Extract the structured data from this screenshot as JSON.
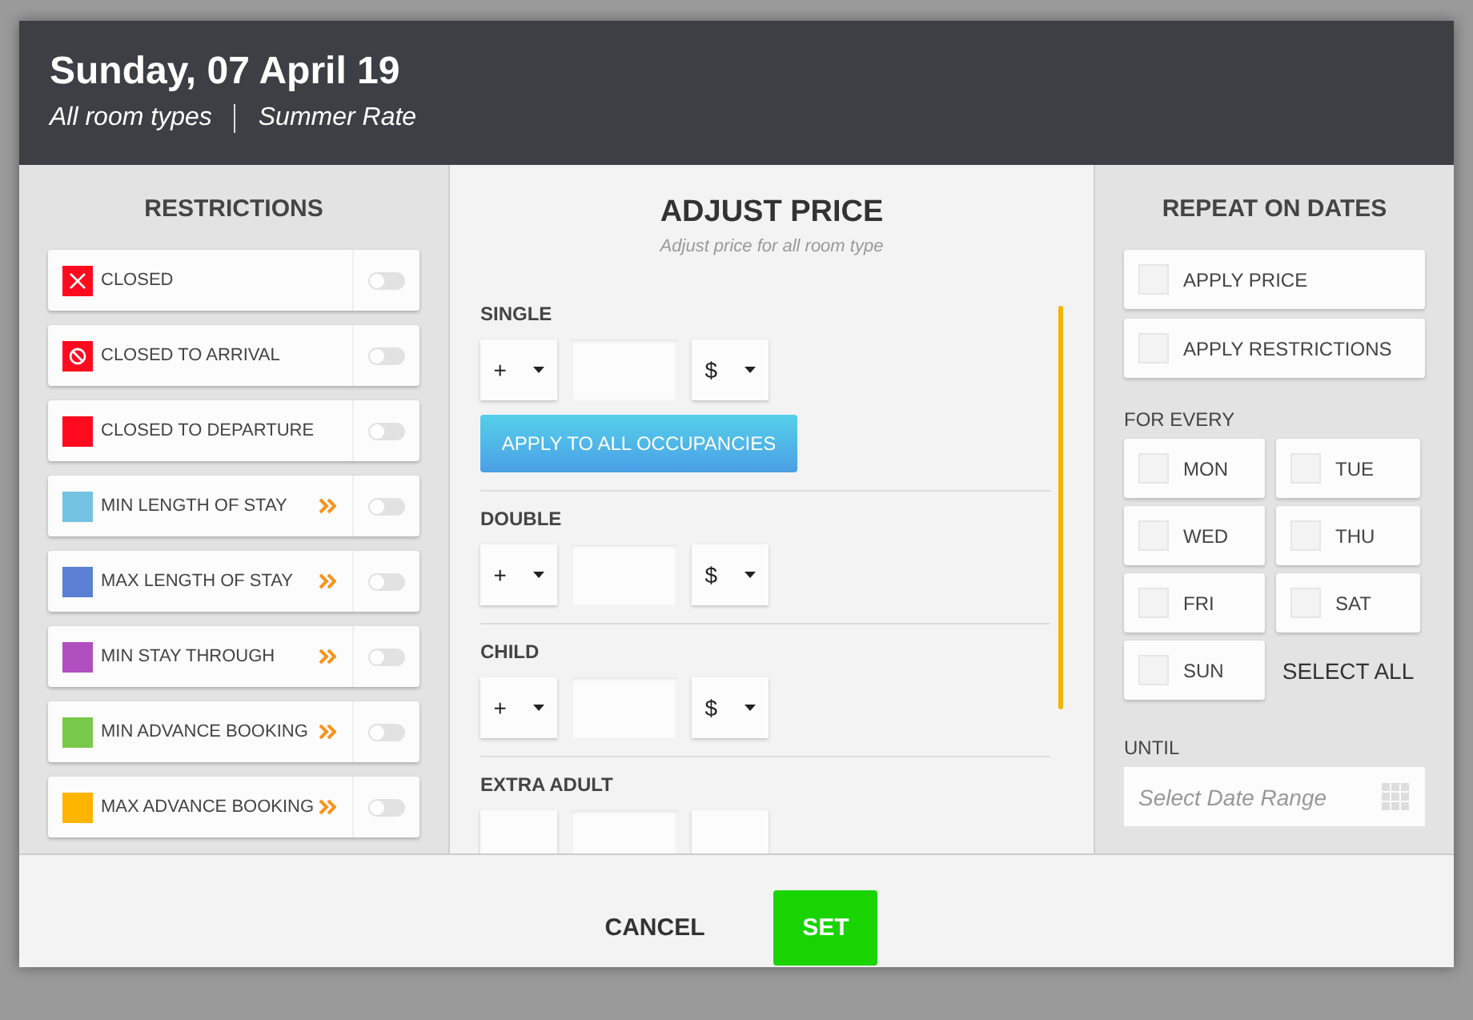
{
  "header": {
    "title": "Sunday, 07 April 19",
    "room_type": "All room types",
    "rate": "Summer Rate"
  },
  "restrictions": {
    "title": "RESTRICTIONS",
    "items": [
      {
        "label": "CLOSED",
        "color": "#ff0a1e",
        "kind": "closed",
        "has_arrows": false,
        "on": false
      },
      {
        "label": "CLOSED TO ARRIVAL",
        "color": "#ff0a1e",
        "kind": "no-arrival",
        "has_arrows": false,
        "on": false
      },
      {
        "label": "CLOSED TO DEPARTURE",
        "color": "#ff0a1e",
        "kind": "plain",
        "has_arrows": false,
        "on": false
      },
      {
        "label": "MIN LENGTH OF STAY",
        "color": "#74c2e1",
        "kind": "plain",
        "has_arrows": true,
        "on": false
      },
      {
        "label": "MAX LENGTH OF STAY",
        "color": "#5b7fd4",
        "kind": "plain",
        "has_arrows": true,
        "on": false
      },
      {
        "label": "MIN STAY THROUGH",
        "color": "#b14fc0",
        "kind": "plain",
        "has_arrows": true,
        "on": false
      },
      {
        "label": "MIN ADVANCE BOOKING",
        "color": "#78c84a",
        "kind": "plain",
        "has_arrows": true,
        "on": false
      },
      {
        "label": "MAX ADVANCE BOOKING",
        "color": "#ffb400",
        "kind": "plain",
        "has_arrows": true,
        "on": false
      }
    ]
  },
  "adjust_price": {
    "title": "ADJUST PRICE",
    "subtitle": "Adjust price for all room type",
    "apply_button": "APPLY TO ALL OCCUPANCIES",
    "occupancies": [
      {
        "label": "SINGLE",
        "sign": "+",
        "unit": "$",
        "has_apply": true
      },
      {
        "label": "DOUBLE",
        "sign": "+",
        "unit": "$",
        "has_apply": false
      },
      {
        "label": "CHILD",
        "sign": "+",
        "unit": "$",
        "has_apply": false
      },
      {
        "label": "EXTRA ADULT",
        "has_apply": false
      }
    ]
  },
  "repeat": {
    "title": "REPEAT ON DATES",
    "options": [
      {
        "label": "APPLY PRICE",
        "checked": false
      },
      {
        "label": "APPLY RESTRICTIONS",
        "checked": false
      }
    ],
    "for_every": "FOR EVERY",
    "days": [
      {
        "label": "MON",
        "checked": false
      },
      {
        "label": "TUE",
        "checked": false
      },
      {
        "label": "WED",
        "checked": false
      },
      {
        "label": "THU",
        "checked": false
      },
      {
        "label": "FRI",
        "checked": false
      },
      {
        "label": "SAT",
        "checked": false
      },
      {
        "label": "SUN",
        "checked": false
      }
    ],
    "select_all": "SELECT ALL",
    "until": "UNTIL",
    "date_placeholder": "Select Date Range"
  },
  "footer": {
    "cancel": "CANCEL",
    "set": "SET"
  }
}
